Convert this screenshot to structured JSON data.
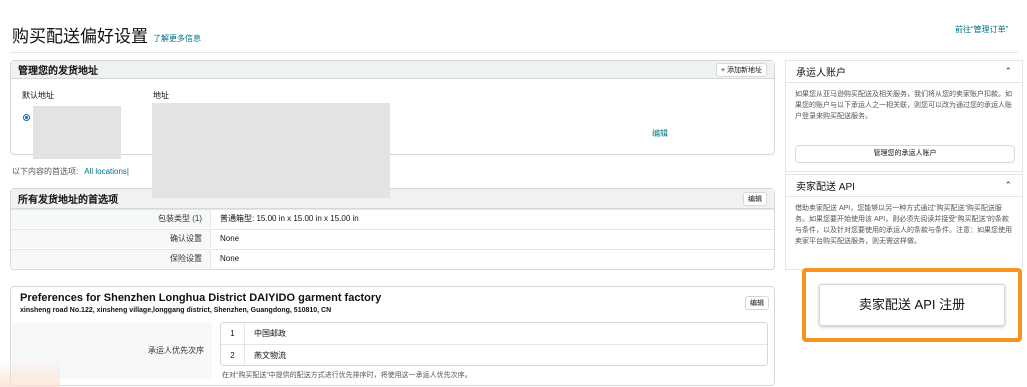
{
  "header": {
    "title": "购买配送偏好设置",
    "learn_more": "了解更多信息",
    "goto_orders": "前往“管理订单”"
  },
  "address_panel": {
    "title": "管理您的发货地址",
    "add_button": "+ 添加新地址",
    "col_default": "默认地址",
    "col_address": "地址",
    "edit": "编辑"
  },
  "filter": {
    "label": "以下内容的首选项:",
    "location": "All locations",
    "separator": "|"
  },
  "all_prefs": {
    "title": "所有发货地址的首选项",
    "edit": "编辑",
    "rows": [
      {
        "label": "包装类型 (1)",
        "value": "普通箱型: 15.00 in x 15.00 in x 15.00 in"
      },
      {
        "label": "确认设置",
        "value": "None"
      },
      {
        "label": "保险设置",
        "value": "None"
      }
    ]
  },
  "factory_prefs": {
    "title": "Preferences for Shenzhen Longhua District DAIYIDO garment factory",
    "subtitle": "xinsheng road No.122, xinsheng village,longgang district, Shenzhen, Guangdong, 510810, CN",
    "edit": "编辑",
    "carrier_label": "承运人优先次序",
    "carriers": [
      {
        "num": "1",
        "name": "中国邮政"
      },
      {
        "num": "2",
        "name": "燕文物流"
      }
    ],
    "note": "在对“购买配送”中提供的配送方式进行优先排序时，将使用这一承运人优先次序。"
  },
  "carrier_account": {
    "title": "承运人账户",
    "text": "如果您从亚马逊购买配送及相关服务，我们将从您的卖家账户扣款。如果您的账户与以下承运人之一相关联，则您可以改为通过您的承运人账户登录来购买配送服务。",
    "button": "管理您的承运人账户"
  },
  "seller_api": {
    "title": "卖家配送 API",
    "text": "借助卖家配送 API，您能够以另一种方式通过“购买配送”购买配送服务。如果您要开始使用该 API，则必须先阅读并接受“购买配送”的条款与条件，以及针对您要使用的承运人的条款与条件。注意：如果您使用卖家平台购买配送服务，则无需这样做。",
    "register_button": "卖家配送 API 注册"
  },
  "colors": {
    "link": "#007185",
    "highlight": "#f79421",
    "panel_head": "#f0f2f2"
  }
}
